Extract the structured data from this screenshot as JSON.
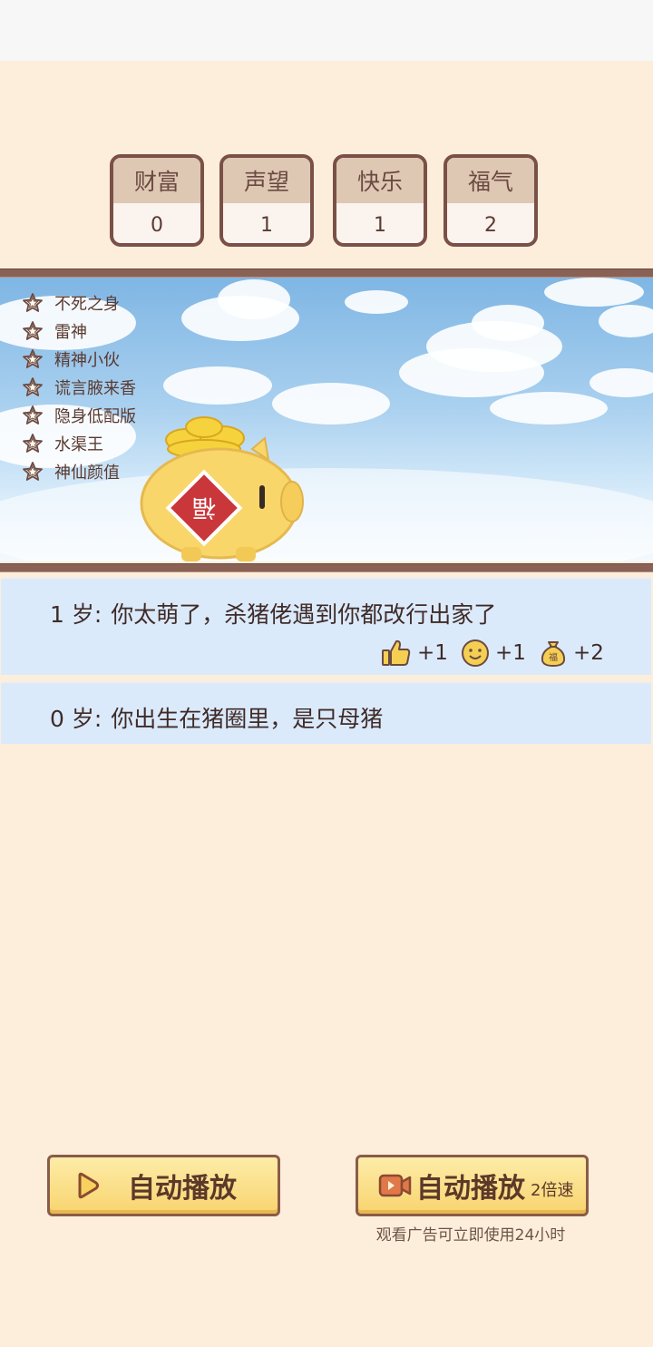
{
  "stats": [
    {
      "label": "财富",
      "value": "0"
    },
    {
      "label": "声望",
      "value": "1"
    },
    {
      "label": "快乐",
      "value": "1"
    },
    {
      "label": "福气",
      "value": "2"
    }
  ],
  "talents": [
    "不死之身",
    "雷神",
    "精神小伙",
    "谎言腋来香",
    "隐身低配版",
    "水渠王",
    "神仙颜值"
  ],
  "pig_badge": "福",
  "log": [
    {
      "age": "1 岁:",
      "text": "你太萌了，杀猪佬遇到你都改行出家了",
      "rewards": [
        {
          "icon": "thumbs-up-icon",
          "value": "+1"
        },
        {
          "icon": "smiley-icon",
          "value": "+1"
        },
        {
          "icon": "money-bag-icon",
          "value": "+2",
          "badge": "福"
        }
      ]
    },
    {
      "age": "0 岁:",
      "text": "你出生在猪圈里，是只母猪"
    }
  ],
  "buttons": {
    "auto_play": "自动播放",
    "auto_play_ad": "自动播放",
    "speed_label": "2倍速",
    "ad_note": "观看广告可立即使用24小时"
  },
  "colors": {
    "background": "#fdeedb",
    "log_bg": "#dbeafb",
    "button": "#f8d46f",
    "border": "#7a5047"
  }
}
